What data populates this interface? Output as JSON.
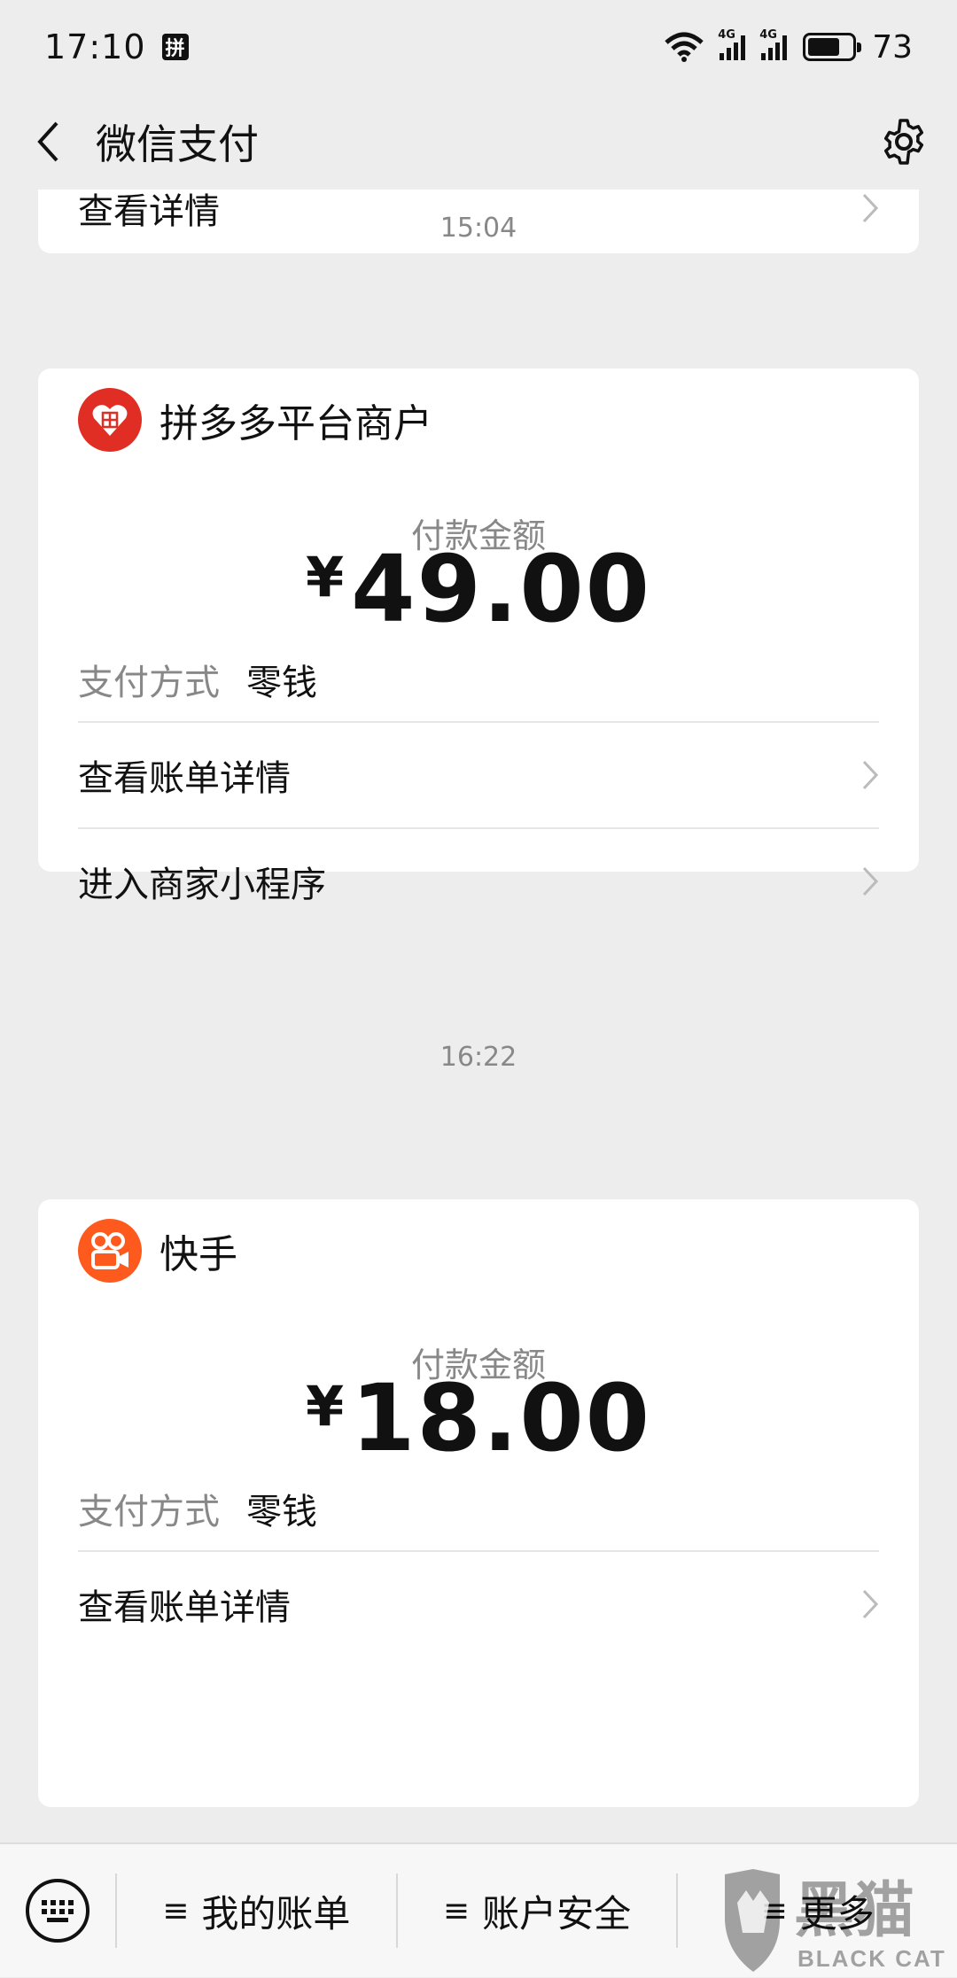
{
  "status_bar": {
    "time": "17:10",
    "app_icon_glyph": "拼",
    "network_1": "4G",
    "network_2": "4G",
    "battery_level": 73,
    "battery_text": "73"
  },
  "header": {
    "title": "微信支付"
  },
  "top_card": {
    "row_label": "查看详情"
  },
  "payments": [
    {
      "time": "15:04",
      "merchant": "拼多多平台商户",
      "merchant_color": "#e02e24",
      "amount_label": "付款金额",
      "currency": "¥",
      "amount": "49.00",
      "method_label": "支付方式",
      "method_value": "零钱",
      "rows": [
        "查看账单详情",
        "进入商家小程序"
      ]
    },
    {
      "time": "16:22",
      "merchant": "快手",
      "merchant_color": "#fe5a1d",
      "amount_label": "付款金额",
      "currency": "¥",
      "amount": "18.00",
      "method_label": "支付方式",
      "method_value": "零钱",
      "rows": [
        "查看账单详情"
      ]
    }
  ],
  "bottom_menu": {
    "items": [
      "我的账单",
      "账户安全",
      "更多"
    ]
  },
  "watermark": {
    "text": "黑猫",
    "subtext": "BLACK CAT"
  }
}
